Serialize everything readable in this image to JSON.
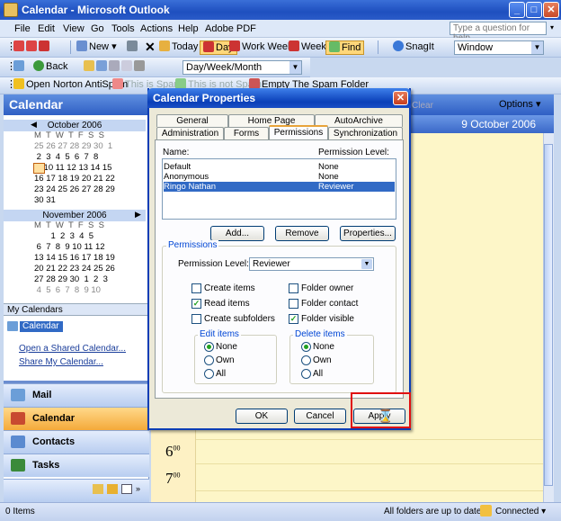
{
  "window": {
    "title": "Calendar - Microsoft Outlook"
  },
  "menu": [
    "File",
    "Edit",
    "View",
    "Go",
    "Tools",
    "Actions",
    "Help",
    "Adobe PDF"
  ],
  "help_placeholder": "Type a question for help",
  "toolbar1": {
    "new": "New",
    "today": "Today",
    "day": "Day",
    "work_week": "Work Week",
    "week": "Week",
    "find": "Find",
    "snagit": "SnagIt",
    "window_combo": "Window"
  },
  "toolbar2": {
    "back": "Back",
    "view_combo": "Day/Week/Month"
  },
  "toolbar3": {
    "norton": "Open Norton AntiSpam",
    "is_spam": "This is Spam",
    "not_spam": "This is not Spam",
    "empty": "Empty The Spam Folder",
    "clear": "Clear"
  },
  "nav": {
    "title": "Calendar",
    "month1": "October 2006",
    "weekdays": "M  T  W  T  F  S  S",
    "oct_rows": [
      "25 26 27 28 29 30  1",
      " 2  3  4  5  6  7  8",
      " 9 10 11 12 13 14 15",
      "16 17 18 19 20 21 22",
      "23 24 25 26 27 28 29",
      "30 31"
    ],
    "today_day": "9",
    "month2": "November 2006",
    "nov_rows": [
      "       1  2  3  4  5",
      " 6  7  8  9 10 11 12",
      "13 14 15 16 17 18 19",
      "20 21 22 23 24 25 26",
      "27 28 29 30  1  2  3",
      " 4  5  6  7  8  9 10"
    ],
    "my_calendars": "My Calendars",
    "calendar_item": "Calendar",
    "open_shared": "Open a Shared Calendar...",
    "share_mine": "Share My Calendar...",
    "mail": "Mail",
    "calendar": "Calendar",
    "contacts": "Contacts",
    "tasks": "Tasks"
  },
  "main": {
    "options": "Options ▾",
    "date": "9 October 2006",
    "hours": [
      "6",
      "7"
    ],
    "minutes": "00"
  },
  "status": {
    "items": "0 Items",
    "sync": "All folders are up to date.",
    "conn": "Connected ▾"
  },
  "dialog": {
    "title": "Calendar Properties",
    "tabs_back": [
      "General",
      "Home Page",
      "AutoArchive"
    ],
    "tabs_front": [
      "Administration",
      "Forms",
      "Permissions",
      "Synchronization"
    ],
    "name_hdr": "Name:",
    "perm_hdr": "Permission Level:",
    "rows": [
      {
        "name": "Default",
        "level": "None"
      },
      {
        "name": "Anonymous",
        "level": "None"
      },
      {
        "name": "Ringo Nathan",
        "level": "Reviewer"
      }
    ],
    "add": "Add...",
    "remove": "Remove",
    "properties": "Properties...",
    "permissions_group": "Permissions",
    "perm_level_label": "Permission Level:",
    "perm_level_value": "Reviewer",
    "checks": {
      "create_items": "Create items",
      "read_items": "Read items",
      "create_subfolders": "Create subfolders",
      "folder_owner": "Folder owner",
      "folder_contact": "Folder contact",
      "folder_visible": "Folder visible"
    },
    "edit_items": "Edit items",
    "delete_items": "Delete items",
    "radio_none": "None",
    "radio_own": "Own",
    "radio_all": "All",
    "ok": "OK",
    "cancel": "Cancel",
    "apply": "Apply"
  }
}
